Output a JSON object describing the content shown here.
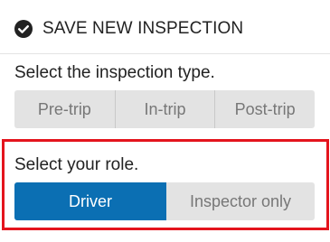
{
  "header": {
    "title": "SAVE NEW INSPECTION",
    "icon": "check-circle-icon"
  },
  "inspection_type": {
    "prompt": "Select the inspection type.",
    "options": [
      "Pre-trip",
      "In-trip",
      "Post-trip"
    ],
    "selected": null
  },
  "role": {
    "prompt": "Select your role.",
    "options": [
      "Driver",
      "Inspector only"
    ],
    "selected": "Driver"
  },
  "colors": {
    "selected_bg": "#0b6fb3",
    "unselected_bg": "#e3e3e3",
    "highlight_border": "#e4141d"
  }
}
